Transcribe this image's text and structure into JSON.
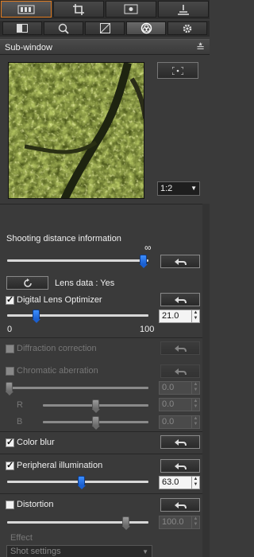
{
  "toolbar": {
    "tools": [
      {
        "name": "basic-image-adjustment",
        "icon": "rgb-bars-icon",
        "active": true
      },
      {
        "name": "crop",
        "icon": "crop-icon",
        "active": false
      },
      {
        "name": "image-view",
        "icon": "image-icon",
        "active": false
      },
      {
        "name": "output",
        "icon": "stamp-icon",
        "active": false
      }
    ],
    "tabs": [
      {
        "icon": "tone-icon",
        "active": false
      },
      {
        "icon": "nr-zoom-icon",
        "active": false
      },
      {
        "icon": "curve-icon",
        "active": false
      },
      {
        "icon": "lens-icon",
        "active": true
      },
      {
        "icon": "gear-icon",
        "active": false
      }
    ],
    "accent_color": "#e07b20"
  },
  "subwindow": {
    "title": "Sub-window",
    "zoom": "1:2"
  },
  "lens": {
    "shooting_distance_label": "Shooting distance information",
    "infinity_symbol": "∞",
    "distance_value": 0.96,
    "lens_data_label": "Lens data : Yes",
    "dlo": {
      "label": "Digital Lens Optimizer",
      "checked": true,
      "value": "21.0",
      "min": "0",
      "max": "100",
      "position": 0.21
    },
    "diffraction": {
      "label": "Diffraction correction",
      "checked": false
    },
    "chromatic": {
      "label": "Chromatic aberration",
      "checked": false,
      "main_value": "0.0",
      "r_label": "R",
      "r_value": "0.0",
      "b_label": "B",
      "b_value": "0.0"
    },
    "color_blur": {
      "label": "Color blur",
      "checked": true
    },
    "peripheral": {
      "label": "Peripheral illumination",
      "checked": true,
      "value": "63.0",
      "position": 0.5
    },
    "distortion": {
      "label": "Distortion",
      "checked": false,
      "value": "100.0",
      "position": 0.85
    },
    "effect": {
      "label": "Effect",
      "selected": "Shot settings"
    }
  },
  "colors": {
    "slider_active": "#1a5fd0",
    "panel": "#3a3a3a"
  }
}
